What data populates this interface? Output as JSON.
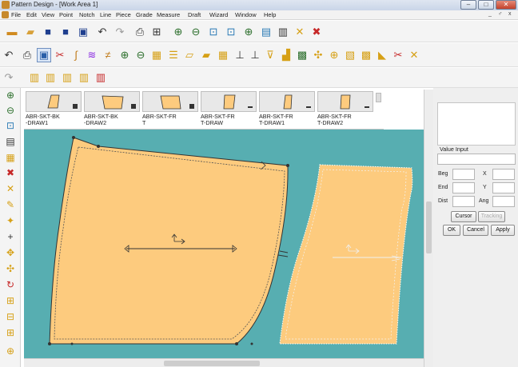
{
  "window": {
    "title": "Pattern Design - [Work Area 1]",
    "controls": [
      "–",
      "□",
      "✕"
    ],
    "mdi_controls": [
      "_",
      "♂",
      "x"
    ]
  },
  "menu": [
    "File",
    "Edit",
    "View",
    "Point",
    "Notch",
    "Line",
    "Piece",
    "Grade",
    "Measure",
    "Draft",
    "Wizard",
    "Window",
    "Help"
  ],
  "toolbar1": [
    "new-piece-icon",
    "open-icon",
    "save-icon",
    "save-all-icon",
    "save-as-icon",
    "undo-icon",
    "redo-icon",
    "print-icon",
    "plot-icon",
    "zoom-in-icon",
    "zoom-out-icon",
    "zoom-piece-icon",
    "zoom-select-icon",
    "zoom-previous-icon",
    "zoom-fit-icon",
    "measure-icon",
    "clear-icon",
    "delete-icon"
  ],
  "toolbar2": [
    "undo-icon",
    "print-icon",
    "select-icon",
    "pattern-icon",
    "curve-icon",
    "line-tool-icon",
    "zoom-in-icon",
    "zoom-out-icon",
    "layout-icon",
    "grid-icon",
    "piece-icon",
    "move-icon",
    "grade-icon",
    "split-icon",
    "notch-icon",
    "mirror-icon",
    "seam-icon",
    "dart-icon",
    "pleat-icon",
    "drill-icon",
    "fold-icon",
    "close-icon"
  ],
  "toolbar3": [
    "redo-icon",
    "draw-piece-icon",
    "draw-piece-2-icon",
    "draw-piece-3-icon",
    "draw-piece-4-icon",
    "delete-piece-icon"
  ],
  "leftbar": [
    "zoom-in-icon",
    "zoom-out-icon",
    "zoom-piece-icon",
    "notes-icon",
    "table-icon",
    "delete-icon",
    "erase-icon",
    "pencil-icon",
    "star-icon",
    "add-point-icon",
    "move-point-icon",
    "scale-icon",
    "rotate-icon",
    "resize-icon",
    "insert-icon",
    "paste-icon",
    "edit-icon"
  ],
  "pieces": [
    {
      "name": "ABR-SKT-BK\n-DRAW1"
    },
    {
      "name": "ABR-SKT-BK\n-DRAW2"
    },
    {
      "name": "ABR-SKT-FR\nT"
    },
    {
      "name": "ABR-SKT-FR\nT-DRAW"
    },
    {
      "name": "ABR-SKT-FR\nT-DRAW1"
    },
    {
      "name": "ABR-SKT-FR\nT-DRAW2"
    }
  ],
  "value_input": {
    "title": "Value Input",
    "beg_label": "Beg",
    "end_label": "End",
    "dist_label": "Dist",
    "x_label": "X",
    "y_label": "Y",
    "ang_label": "Ang",
    "cursor_label": "Cursor",
    "tracking_label": "Tracking",
    "ok_label": "OK",
    "cancel_label": "Cancel",
    "apply_label": "Apply"
  },
  "colors": {
    "workarea_bg": "#57aeb1",
    "piece_fill": "#fdcb7e",
    "piece_outline": "#333333",
    "seam_line": "#888888"
  }
}
